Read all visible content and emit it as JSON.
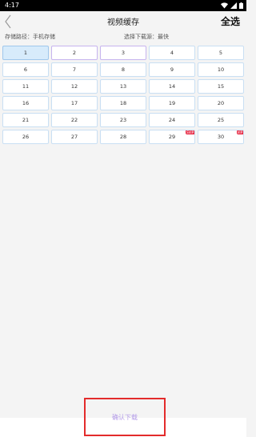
{
  "status_bar": {
    "time": "4:17",
    "icons": [
      "wifi-icon",
      "signal-icon",
      "battery-icon"
    ]
  },
  "header": {
    "back_icon": "chevron-left-icon",
    "title": "视频缓存",
    "select_all_label": "全选"
  },
  "info": {
    "storage_path": "存储路径：手机存储",
    "download_source": "选择下载源：最快"
  },
  "episodes": [
    {
      "label": "1",
      "state": "selected"
    },
    {
      "label": "2",
      "state": "outlined"
    },
    {
      "label": "3",
      "state": "outlined"
    },
    {
      "label": "4",
      "state": "normal"
    },
    {
      "label": "5",
      "state": "normal"
    },
    {
      "label": "6",
      "state": "normal"
    },
    {
      "label": "7",
      "state": "normal"
    },
    {
      "label": "8",
      "state": "normal"
    },
    {
      "label": "9",
      "state": "normal"
    },
    {
      "label": "10",
      "state": "normal"
    },
    {
      "label": "11",
      "state": "normal"
    },
    {
      "label": "12",
      "state": "normal"
    },
    {
      "label": "13",
      "state": "normal"
    },
    {
      "label": "14",
      "state": "normal"
    },
    {
      "label": "15",
      "state": "normal"
    },
    {
      "label": "16",
      "state": "normal"
    },
    {
      "label": "17",
      "state": "normal"
    },
    {
      "label": "18",
      "state": "normal"
    },
    {
      "label": "19",
      "state": "normal"
    },
    {
      "label": "20",
      "state": "normal"
    },
    {
      "label": "21",
      "state": "normal"
    },
    {
      "label": "22",
      "state": "normal"
    },
    {
      "label": "23",
      "state": "normal"
    },
    {
      "label": "24",
      "state": "normal"
    },
    {
      "label": "25",
      "state": "normal"
    },
    {
      "label": "26",
      "state": "normal"
    },
    {
      "label": "27",
      "state": "normal"
    },
    {
      "label": "28",
      "state": "normal"
    },
    {
      "label": "29",
      "state": "normal",
      "badge": "SVIP"
    },
    {
      "label": "30",
      "state": "normal",
      "badge": "VIP"
    }
  ],
  "footer": {
    "confirm_label": "确认下载"
  },
  "colors": {
    "selected_bg": "#d7ebfb",
    "tile_border": "#c9dff3",
    "outlined_border": "#c6b4ee",
    "badge_bg": "#e8304a",
    "confirm_text": "#b39be8",
    "highlight_border": "#e32b2b"
  }
}
